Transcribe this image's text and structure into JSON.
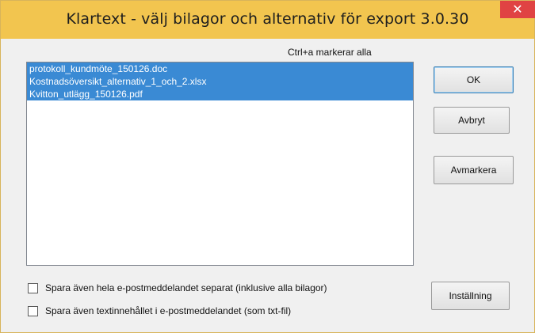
{
  "window": {
    "title": "Klartext - välj bilagor och alternativ för export  3.0.30",
    "close_label": "✕"
  },
  "hint": "Ctrl+a markerar alla",
  "attachments": [
    "protokoll_kundmöte_150126.doc",
    "Kostnadsöversikt_alternativ_1_och_2.xlsx",
    "Kvitton_utlägg_150126.pdf"
  ],
  "buttons": {
    "ok": "OK",
    "cancel": "Avbryt",
    "deselect": "Avmarkera",
    "settings": "Inställning"
  },
  "options": {
    "save_whole_email": "Spara även hela e-postmeddelandet separat (inklusive alla bilagor)",
    "save_text_content": "Spara även textinnehållet i e-postmeddelandet (som txt-fil)"
  },
  "colors": {
    "titlebar": "#f2c54f",
    "selection": "#3a8ad4",
    "close_button": "#e04343"
  }
}
